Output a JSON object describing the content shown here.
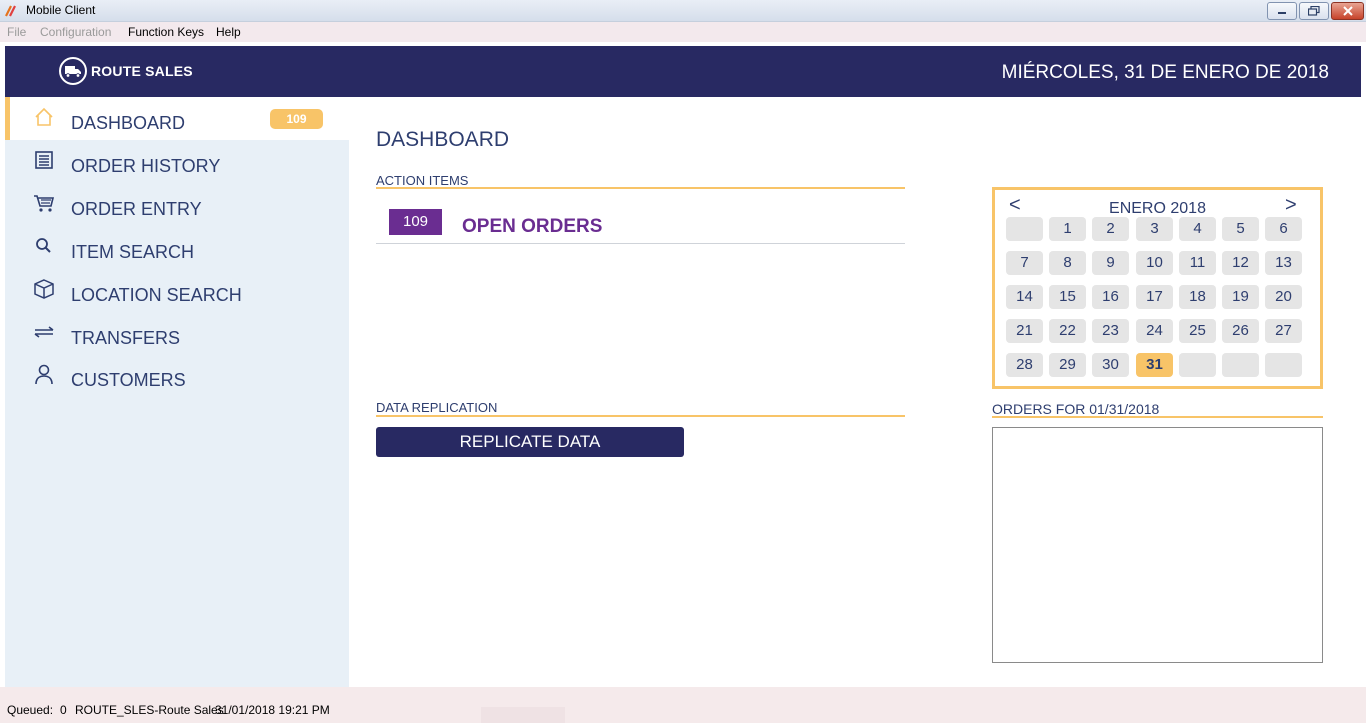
{
  "window": {
    "title": "Mobile Client",
    "controls": [
      "minimize",
      "restore",
      "close"
    ]
  },
  "menu": {
    "items": [
      {
        "label": "File",
        "enabled": false
      },
      {
        "label": "Configuration",
        "enabled": false
      },
      {
        "label": "Function Keys",
        "enabled": true
      },
      {
        "label": "Help",
        "enabled": true
      }
    ]
  },
  "header": {
    "logo_text": "ROUTE SALES",
    "logo_icon": "truck-icon",
    "date": "MIÉRCOLES, 31 DE ENERO DE 2018"
  },
  "sidebar": {
    "items": [
      {
        "label": "DASHBOARD",
        "icon": "home-icon",
        "active": true,
        "badge": "109"
      },
      {
        "label": "ORDER HISTORY",
        "icon": "list-icon"
      },
      {
        "label": "ORDER ENTRY",
        "icon": "cart-icon"
      },
      {
        "label": "ITEM SEARCH",
        "icon": "search-icon"
      },
      {
        "label": "LOCATION SEARCH",
        "icon": "box-icon"
      },
      {
        "label": "TRANSFERS",
        "icon": "transfer-arrows-icon"
      },
      {
        "label": "CUSTOMERS",
        "icon": "user-icon"
      }
    ]
  },
  "main": {
    "title": "DASHBOARD",
    "action_items": {
      "heading": "ACTION ITEMS",
      "open_orders_count": "109",
      "open_orders_label": "OPEN ORDERS"
    },
    "data_replication": {
      "heading": "DATA REPLICATION",
      "button_label": "REPLICATE DATA"
    },
    "calendar": {
      "prev": "<",
      "next": ">",
      "month_label": "ENERO 2018",
      "weeks": [
        [
          "",
          "1",
          "2",
          "3",
          "4",
          "5",
          "6"
        ],
        [
          "7",
          "8",
          "9",
          "10",
          "11",
          "12",
          "13"
        ],
        [
          "14",
          "15",
          "16",
          "17",
          "18",
          "19",
          "20"
        ],
        [
          "21",
          "22",
          "23",
          "24",
          "25",
          "26",
          "27"
        ],
        [
          "28",
          "29",
          "30",
          "31",
          "",
          "",
          ""
        ]
      ],
      "selected_day": "31"
    },
    "orders_for_label": "ORDERS FOR 01/31/2018"
  },
  "status": {
    "queued_label": "Queued:",
    "queued_value": "0",
    "route": "ROUTE_SLES-Route Sales",
    "datetime": "31/01/2018 19:21 PM"
  },
  "colors": {
    "navy": "#282962",
    "accent": "#f8c468",
    "purple": "#6a2d91",
    "sidebar_bg": "#e8f0f7",
    "text": "#2e3e6f"
  }
}
